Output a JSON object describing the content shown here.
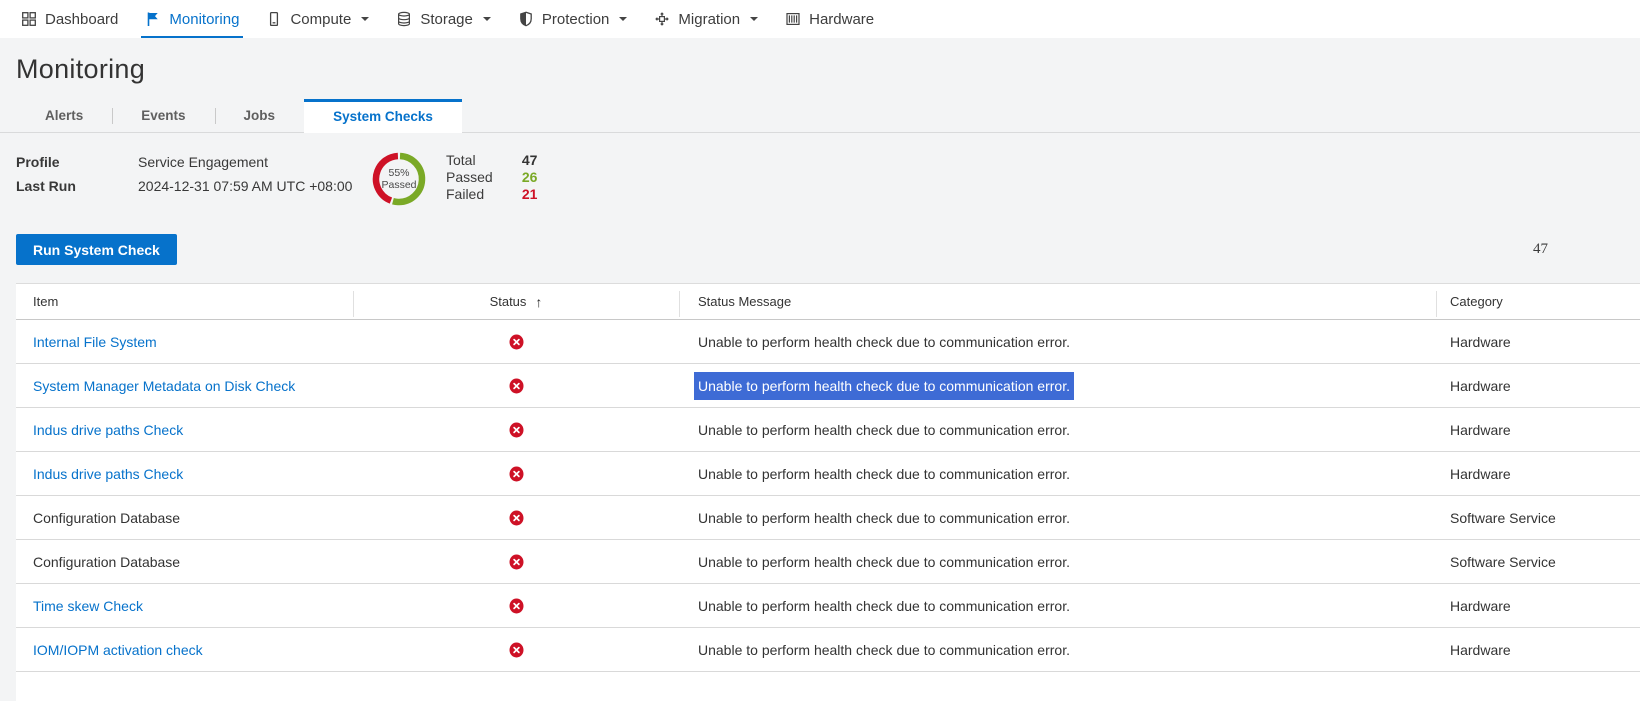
{
  "colors": {
    "accent": "#0672cb",
    "failed_red": "#ce1126",
    "passed_green": "#7aa926",
    "selection_blue": "#3e6bd5"
  },
  "nav": {
    "items": [
      {
        "label": "Dashboard",
        "icon": "dashboard-icon",
        "active": false,
        "caret": false
      },
      {
        "label": "Monitoring",
        "icon": "flag-icon",
        "active": true,
        "caret": false
      },
      {
        "label": "Compute",
        "icon": "server-icon",
        "active": false,
        "caret": true
      },
      {
        "label": "Storage",
        "icon": "storage-disks-icon",
        "active": false,
        "caret": true
      },
      {
        "label": "Protection",
        "icon": "shield-icon",
        "active": false,
        "caret": true
      },
      {
        "label": "Migration",
        "icon": "migration-arrows-icon",
        "active": false,
        "caret": true
      },
      {
        "label": "Hardware",
        "icon": "hardware-chassis-icon",
        "active": false,
        "caret": false
      }
    ]
  },
  "page": {
    "title": "Monitoring"
  },
  "tabs": [
    {
      "label": "Alerts",
      "active": false
    },
    {
      "label": "Events",
      "active": false
    },
    {
      "label": "Jobs",
      "active": false
    },
    {
      "label": "System Checks",
      "active": true
    }
  ],
  "summary": {
    "profile_label": "Profile",
    "profile_value": "Service Engagement",
    "last_run_label": "Last Run",
    "last_run_value": "2024-12-31 07:59 AM UTC +08:00",
    "donut": {
      "percent_label": "55%",
      "center_sub_label": "Passed",
      "passed_pct": 55,
      "failed_pct": 45,
      "green": "#7aa926",
      "red": "#ce1126"
    },
    "legend": [
      {
        "label": "Total",
        "value": "47",
        "color": "#333333"
      },
      {
        "label": "Passed",
        "value": "26",
        "color": "#7aa926"
      },
      {
        "label": "Failed",
        "value": "21",
        "color": "#ce1126"
      }
    ]
  },
  "toolbar": {
    "run_button_label": "Run System Check",
    "result_count": "47"
  },
  "table": {
    "columns": [
      "Item",
      "Status",
      "Status Message",
      "Category"
    ],
    "sort": {
      "column": "Status",
      "direction": "asc",
      "indicator": "↑"
    },
    "rows": [
      {
        "item": "Internal File System",
        "link": true,
        "status": "failed",
        "message": "Unable to perform health check due to communication error.",
        "category": "Hardware",
        "selected_message": false
      },
      {
        "item": "System Manager Metadata on Disk Check",
        "link": true,
        "status": "failed",
        "message": "Unable to perform health check due to communication error.",
        "category": "Hardware",
        "selected_message": true
      },
      {
        "item": "Indus drive paths Check",
        "link": true,
        "status": "failed",
        "message": "Unable to perform health check due to communication error.",
        "category": "Hardware",
        "selected_message": false
      },
      {
        "item": "Indus drive paths Check",
        "link": true,
        "status": "failed",
        "message": "Unable to perform health check due to communication error.",
        "category": "Hardware",
        "selected_message": false
      },
      {
        "item": "Configuration Database",
        "link": false,
        "status": "failed",
        "message": "Unable to perform health check due to communication error.",
        "category": "Software Service",
        "selected_message": false
      },
      {
        "item": "Configuration Database",
        "link": false,
        "status": "failed",
        "message": "Unable to perform health check due to communication error.",
        "category": "Software Service",
        "selected_message": false
      },
      {
        "item": "Time skew Check",
        "link": true,
        "status": "failed",
        "message": "Unable to perform health check due to communication error.",
        "category": "Hardware",
        "selected_message": false
      },
      {
        "item": "IOM/IOPM activation check",
        "link": true,
        "status": "failed",
        "message": "Unable to perform health check due to communication error.",
        "category": "Hardware",
        "selected_message": false
      }
    ]
  }
}
